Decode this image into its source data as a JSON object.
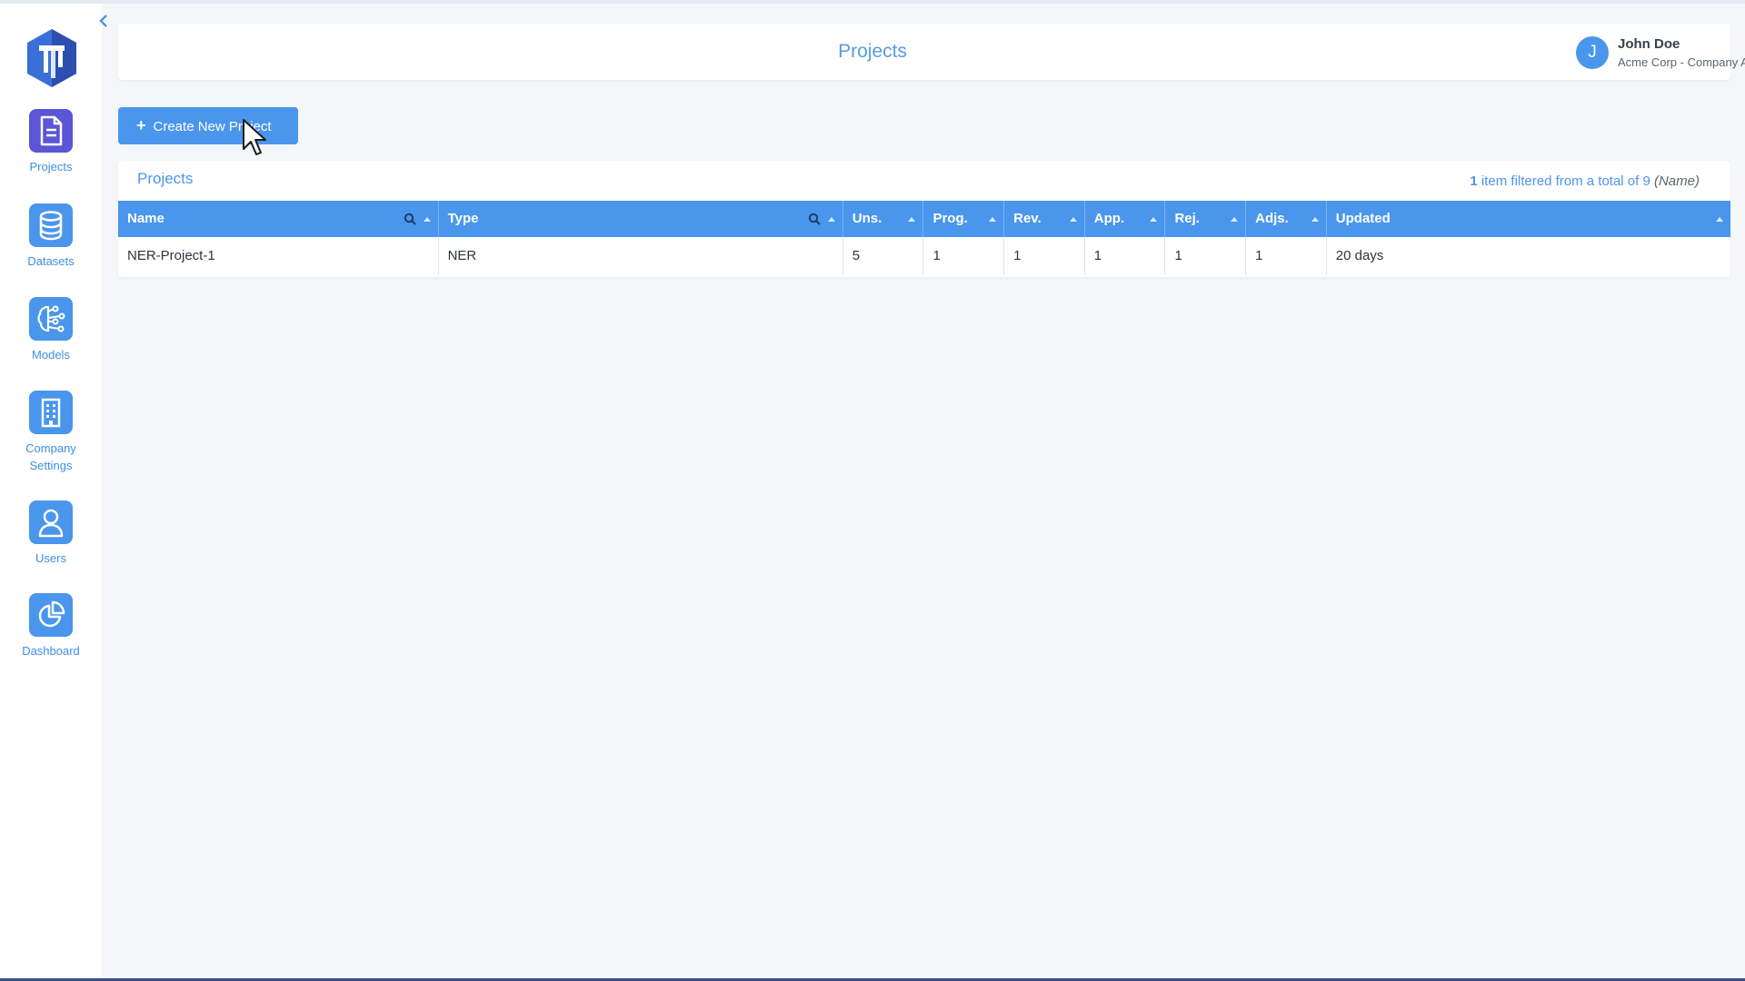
{
  "page": {
    "title": "Projects"
  },
  "sidebar": {
    "items": [
      {
        "label": "Projects",
        "icon": "document-icon",
        "active": true
      },
      {
        "label": "Datasets",
        "icon": "database-icon",
        "active": false
      },
      {
        "label": "Models",
        "icon": "brain-network-icon",
        "active": false
      },
      {
        "label": "Company Settings",
        "icon": "building-icon",
        "active": false
      },
      {
        "label": "Users",
        "icon": "user-icon",
        "active": false
      },
      {
        "label": "Dashboard",
        "icon": "pie-chart-icon",
        "active": false
      }
    ]
  },
  "user": {
    "initial": "J",
    "name": "John Doe",
    "role": "Acme Corp - Company Admin, API User"
  },
  "toolbar": {
    "create_label": "Create New Project"
  },
  "table": {
    "title": "Projects",
    "filter_count": "1",
    "filter_text": " item filtered from a total of 9 ",
    "filter_field": "(Name)",
    "columns": [
      "Name",
      "Type",
      "Uns.",
      "Prog.",
      "Rev.",
      "App.",
      "Rej.",
      "Adjs.",
      "Updated"
    ],
    "rows": [
      {
        "name": "NER-Project-1",
        "type": "NER",
        "uns": "5",
        "prog": "1",
        "rev": "1",
        "app": "1",
        "rej": "1",
        "adjs": "1",
        "updated": "20 days"
      }
    ]
  },
  "colors": {
    "accent": "#4a96ec",
    "active_nav": "#5b56d6",
    "background": "#f5f6f9"
  }
}
